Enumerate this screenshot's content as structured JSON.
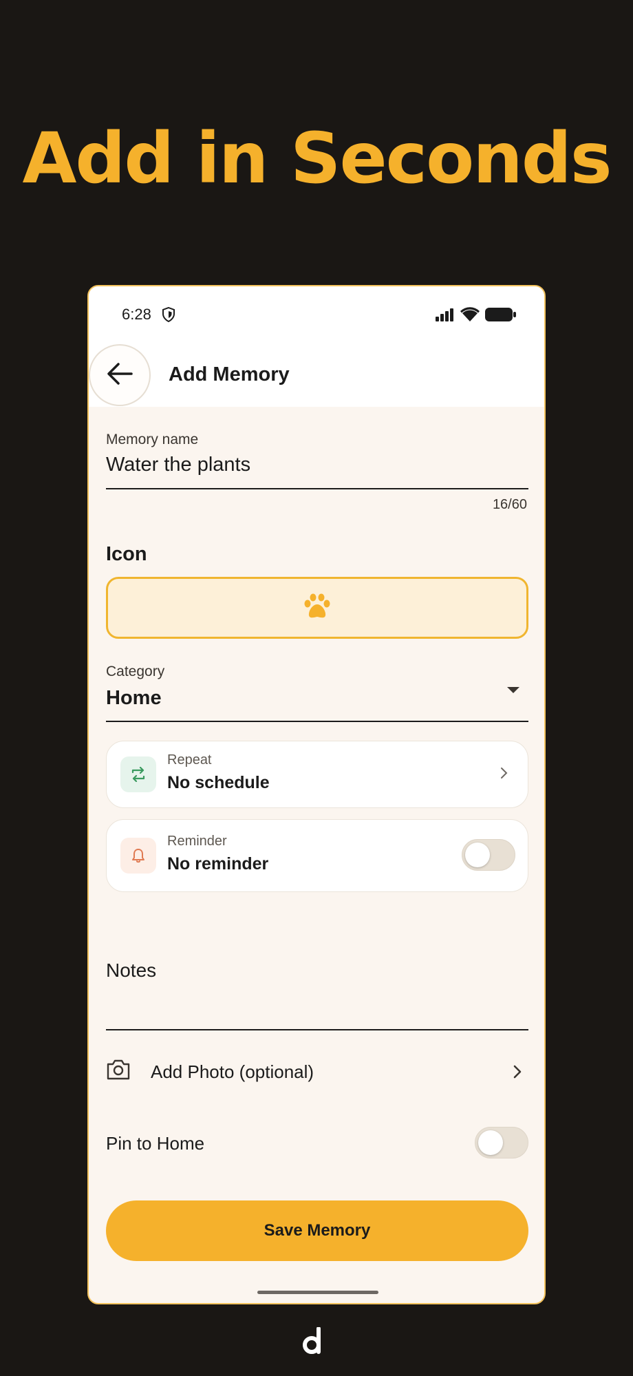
{
  "headline": "Add in Seconds",
  "status_bar": {
    "time": "6:28"
  },
  "app_bar": {
    "title": "Add Memory"
  },
  "memory_name": {
    "label": "Memory name",
    "value": "Water the plants",
    "counter": "16/60"
  },
  "icon_section": {
    "title": "Icon",
    "selected_icon": "paw-icon"
  },
  "category": {
    "label": "Category",
    "value": "Home"
  },
  "repeat": {
    "label": "Repeat",
    "value": "No schedule"
  },
  "reminder": {
    "label": "Reminder",
    "value": "No reminder",
    "enabled": false
  },
  "notes": {
    "label": "Notes"
  },
  "add_photo": {
    "label": "Add Photo (optional)"
  },
  "pin_to_home": {
    "label": "Pin to Home",
    "enabled": false
  },
  "save_button": {
    "label": "Save Memory"
  },
  "colors": {
    "accent": "#f5b12c",
    "background": "#1a1714",
    "screen": "#fbf5ef",
    "repeat_icon_bg": "#e6f4ec",
    "repeat_icon": "#3a9a5e",
    "reminder_icon_bg": "#fdeee6",
    "reminder_icon": "#e07a52"
  }
}
